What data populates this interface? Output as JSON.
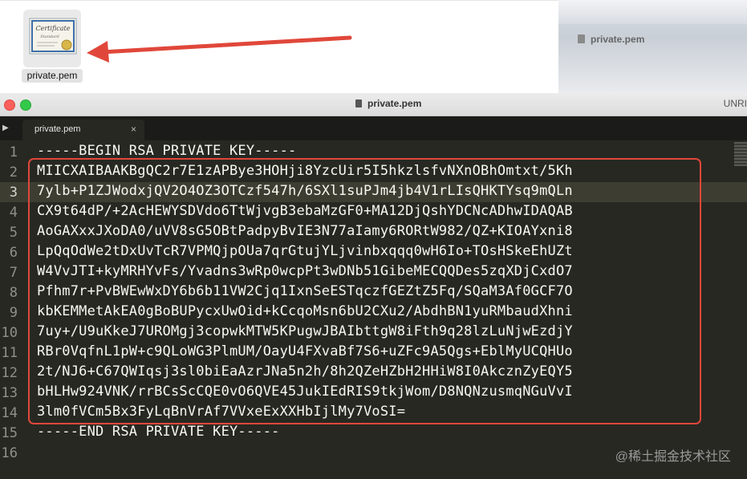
{
  "finder": {
    "file_name": "private.pem",
    "certificate_icon": "certificate-icon",
    "background_window_title": "private.pem"
  },
  "window": {
    "title": "private.pem",
    "right_status": "UNRI"
  },
  "tab": {
    "label": "private.pem",
    "close": "×"
  },
  "editor": {
    "line_numbers": [
      "1",
      "2",
      "3",
      "4",
      "5",
      "6",
      "7",
      "8",
      "9",
      "10",
      "11",
      "12",
      "13",
      "14",
      "15",
      "16"
    ],
    "current_line": 3,
    "lines": [
      "-----BEGIN RSA PRIVATE KEY-----",
      "MIICXAIBAAKBgQC2r7E1zAPBye3HOHji8YzcUir5I5hkzlsfvNXnOBhOmtxt/5Kh",
      "7ylb+P1ZJWodxjQV2O4OZ3OTCzf547h/6SXl1suPJm4jb4V1rLIsQHKTYsq9mQLn",
      "CX9t64dP/+2AcHEWYSDVdo6TtWjvgB3ebaMzGF0+MA12DjQshYDCNcADhwIDAQAB",
      "AoGAXxxJXoDA0/uVV8sG5OBtPadpyBvIE3N77aIamy6RORtW982/QZ+KIOAYxni8",
      "LpQqOdWe2tDxUvTcR7VPMQjpOUa7qrGtujYLjvinbxqqq0wH6Io+TOsHSkeEhUZt",
      "W4VvJTI+kyMRHYvFs/Yvadns3wRp0wcpPt3wDNb51GibeMECQQDes5zqXDjCxdO7",
      "Pfhm7r+PvBWEwWxDY6b6b11VW2Cjq1IxnSeESTqczfGEZtZ5Fq/SQaM3Af0GCF7O",
      "kbKEMMetAkEA0gBoBUPycxUwOid+kCcqoMsn6bU2CXu2/AbdhBN1yuRMbaudXhni",
      "7uy+/U9uKkeJ7UROMgj3copwkMTW5KPugwJBAIbttgW8iFth9q28lzLuNjwEzdjY",
      "RBr0VqfnL1pW+c9QLoWG3PlmUM/OayU4FXvaBf7S6+uZFc9A5Qgs+EblMyUCQHUo",
      "2t/NJ6+C67QWIqsj3sl0biEaAzrJNa5n2h/8h2QZeHZbH2HHiW8I0AkcznZyEQY5",
      "bHLHw924VNK/rrBCsScCQE0vO6QVE45JukIEdRIS9tkjWom/D8NQNzusmqNGuVvI",
      "3lm0fVCm5Bx3FyLqBnVrAf7VVxeExXXHbIjlMy7VoSI=",
      "-----END RSA PRIVATE KEY-----",
      ""
    ]
  },
  "annotation": {
    "arrow_color": "#e0473a",
    "box_color": "#e0473a"
  },
  "watermark": "@稀土掘金技术社区",
  "colors": {
    "editor_bg": "#272822",
    "current_line_bg": "#3e3d32",
    "text": "#f8f8f2",
    "gutter_text": "#8f908a"
  }
}
